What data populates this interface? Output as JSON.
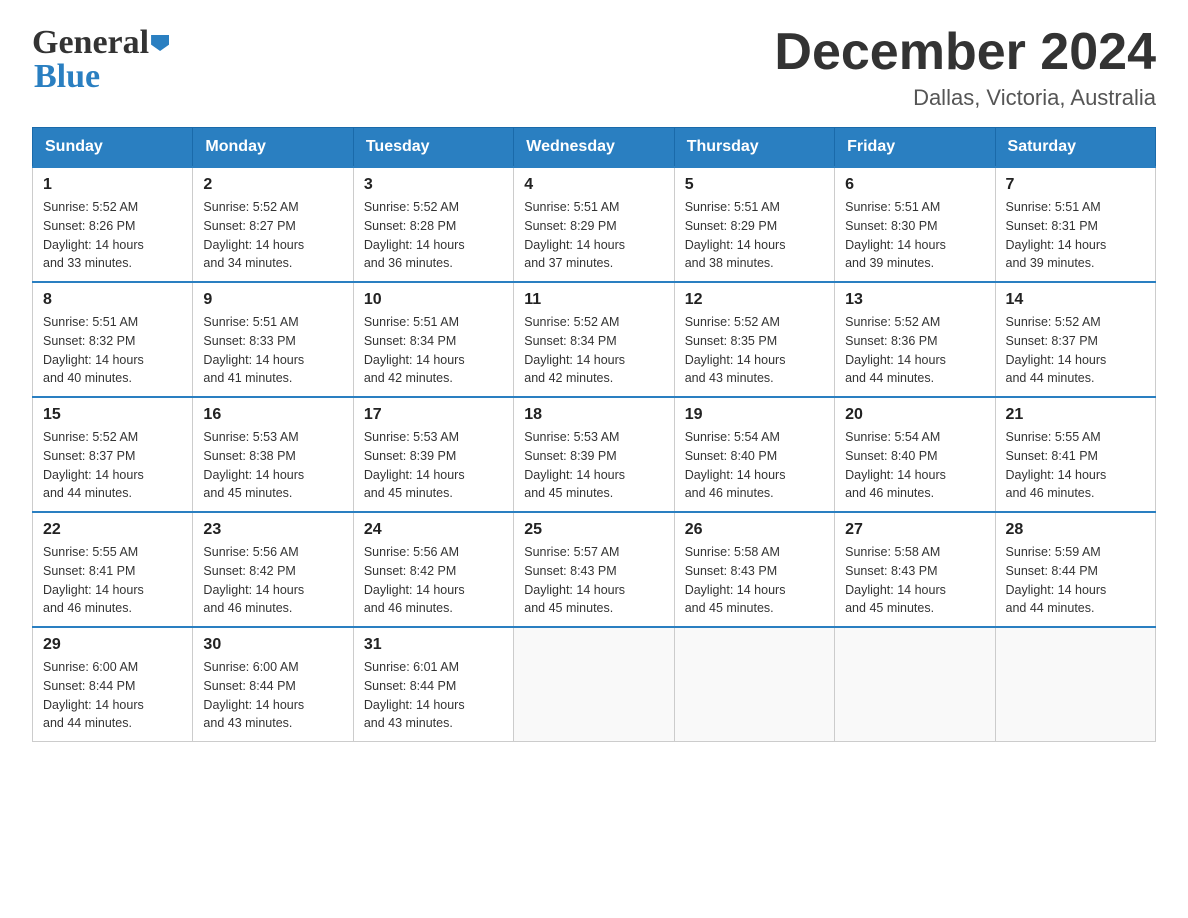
{
  "header": {
    "logo_general": "General",
    "logo_blue": "Blue",
    "month_title": "December 2024",
    "location": "Dallas, Victoria, Australia"
  },
  "days_of_week": [
    "Sunday",
    "Monday",
    "Tuesday",
    "Wednesday",
    "Thursday",
    "Friday",
    "Saturday"
  ],
  "weeks": [
    [
      {
        "day": "1",
        "sunrise": "5:52 AM",
        "sunset": "8:26 PM",
        "daylight": "14 hours and 33 minutes."
      },
      {
        "day": "2",
        "sunrise": "5:52 AM",
        "sunset": "8:27 PM",
        "daylight": "14 hours and 34 minutes."
      },
      {
        "day": "3",
        "sunrise": "5:52 AM",
        "sunset": "8:28 PM",
        "daylight": "14 hours and 36 minutes."
      },
      {
        "day": "4",
        "sunrise": "5:51 AM",
        "sunset": "8:29 PM",
        "daylight": "14 hours and 37 minutes."
      },
      {
        "day": "5",
        "sunrise": "5:51 AM",
        "sunset": "8:29 PM",
        "daylight": "14 hours and 38 minutes."
      },
      {
        "day": "6",
        "sunrise": "5:51 AM",
        "sunset": "8:30 PM",
        "daylight": "14 hours and 39 minutes."
      },
      {
        "day": "7",
        "sunrise": "5:51 AM",
        "sunset": "8:31 PM",
        "daylight": "14 hours and 39 minutes."
      }
    ],
    [
      {
        "day": "8",
        "sunrise": "5:51 AM",
        "sunset": "8:32 PM",
        "daylight": "14 hours and 40 minutes."
      },
      {
        "day": "9",
        "sunrise": "5:51 AM",
        "sunset": "8:33 PM",
        "daylight": "14 hours and 41 minutes."
      },
      {
        "day": "10",
        "sunrise": "5:51 AM",
        "sunset": "8:34 PM",
        "daylight": "14 hours and 42 minutes."
      },
      {
        "day": "11",
        "sunrise": "5:52 AM",
        "sunset": "8:34 PM",
        "daylight": "14 hours and 42 minutes."
      },
      {
        "day": "12",
        "sunrise": "5:52 AM",
        "sunset": "8:35 PM",
        "daylight": "14 hours and 43 minutes."
      },
      {
        "day": "13",
        "sunrise": "5:52 AM",
        "sunset": "8:36 PM",
        "daylight": "14 hours and 44 minutes."
      },
      {
        "day": "14",
        "sunrise": "5:52 AM",
        "sunset": "8:37 PM",
        "daylight": "14 hours and 44 minutes."
      }
    ],
    [
      {
        "day": "15",
        "sunrise": "5:52 AM",
        "sunset": "8:37 PM",
        "daylight": "14 hours and 44 minutes."
      },
      {
        "day": "16",
        "sunrise": "5:53 AM",
        "sunset": "8:38 PM",
        "daylight": "14 hours and 45 minutes."
      },
      {
        "day": "17",
        "sunrise": "5:53 AM",
        "sunset": "8:39 PM",
        "daylight": "14 hours and 45 minutes."
      },
      {
        "day": "18",
        "sunrise": "5:53 AM",
        "sunset": "8:39 PM",
        "daylight": "14 hours and 45 minutes."
      },
      {
        "day": "19",
        "sunrise": "5:54 AM",
        "sunset": "8:40 PM",
        "daylight": "14 hours and 46 minutes."
      },
      {
        "day": "20",
        "sunrise": "5:54 AM",
        "sunset": "8:40 PM",
        "daylight": "14 hours and 46 minutes."
      },
      {
        "day": "21",
        "sunrise": "5:55 AM",
        "sunset": "8:41 PM",
        "daylight": "14 hours and 46 minutes."
      }
    ],
    [
      {
        "day": "22",
        "sunrise": "5:55 AM",
        "sunset": "8:41 PM",
        "daylight": "14 hours and 46 minutes."
      },
      {
        "day": "23",
        "sunrise": "5:56 AM",
        "sunset": "8:42 PM",
        "daylight": "14 hours and 46 minutes."
      },
      {
        "day": "24",
        "sunrise": "5:56 AM",
        "sunset": "8:42 PM",
        "daylight": "14 hours and 46 minutes."
      },
      {
        "day": "25",
        "sunrise": "5:57 AM",
        "sunset": "8:43 PM",
        "daylight": "14 hours and 45 minutes."
      },
      {
        "day": "26",
        "sunrise": "5:58 AM",
        "sunset": "8:43 PM",
        "daylight": "14 hours and 45 minutes."
      },
      {
        "day": "27",
        "sunrise": "5:58 AM",
        "sunset": "8:43 PM",
        "daylight": "14 hours and 45 minutes."
      },
      {
        "day": "28",
        "sunrise": "5:59 AM",
        "sunset": "8:44 PM",
        "daylight": "14 hours and 44 minutes."
      }
    ],
    [
      {
        "day": "29",
        "sunrise": "6:00 AM",
        "sunset": "8:44 PM",
        "daylight": "14 hours and 44 minutes."
      },
      {
        "day": "30",
        "sunrise": "6:00 AM",
        "sunset": "8:44 PM",
        "daylight": "14 hours and 43 minutes."
      },
      {
        "day": "31",
        "sunrise": "6:01 AM",
        "sunset": "8:44 PM",
        "daylight": "14 hours and 43 minutes."
      },
      null,
      null,
      null,
      null
    ]
  ],
  "labels": {
    "sunrise": "Sunrise:",
    "sunset": "Sunset:",
    "daylight": "Daylight:"
  }
}
